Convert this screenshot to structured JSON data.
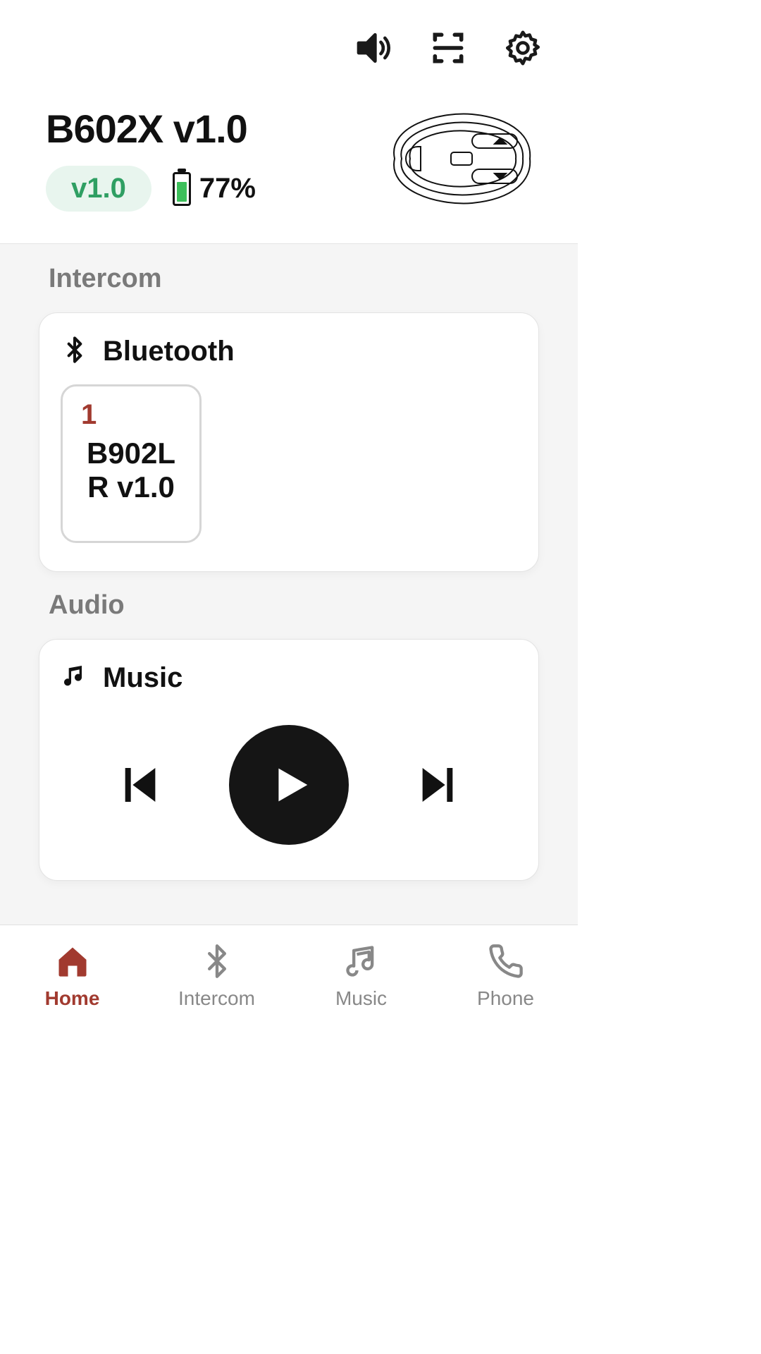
{
  "header": {
    "device_title": "B602X v1.0",
    "version_badge": "v1.0",
    "battery_text": "77%"
  },
  "intercom": {
    "section_label": "Intercom",
    "card_title": "Bluetooth",
    "devices": [
      {
        "index": "1",
        "name_line1": "B902L",
        "name_line2": "R v1.0"
      }
    ]
  },
  "audio": {
    "section_label": "Audio",
    "card_title": "Music"
  },
  "tabs": {
    "home": "Home",
    "intercom": "Intercom",
    "music": "Music",
    "phone": "Phone"
  }
}
